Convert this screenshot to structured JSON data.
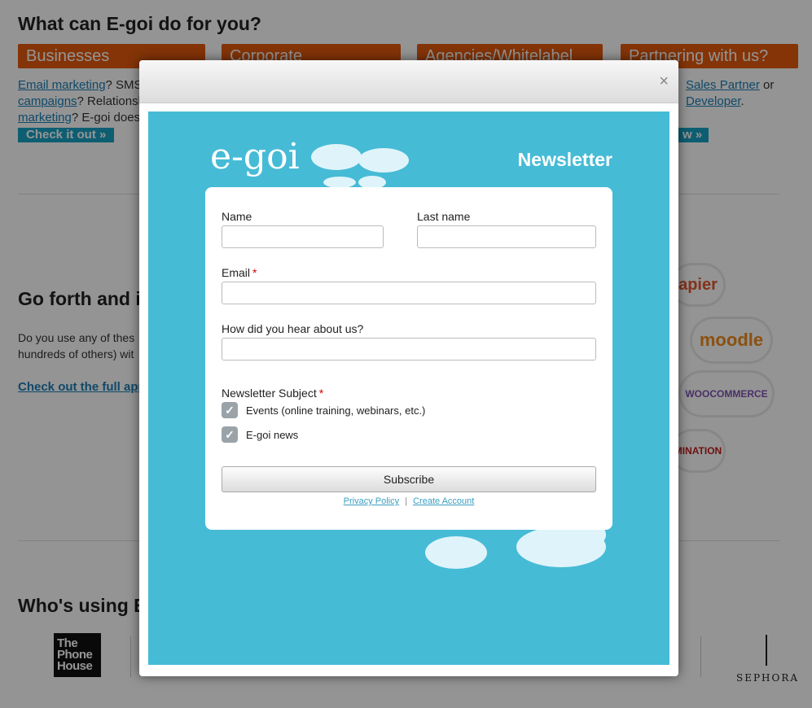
{
  "background": {
    "heading1": "What can E-goi do for you?",
    "tabs": [
      "Businesses",
      "Corporate",
      "Agencies/Whitelabel",
      "Partnering with us?"
    ],
    "col1_line1_link1": "Email marketing",
    "col1_line1_rest": "? SMS",
    "col1_line2_link": "campaigns",
    "col1_line2_rest": "? Relationsh",
    "col1_line3_link": "marketing",
    "col1_line3_rest": "? E-goi does",
    "col1_cta": "Check it out »",
    "col4_line1_link": "Sales Partner",
    "col4_line1_rest": " or",
    "col4_line2_link": "Developer",
    "col4_cta": "w »",
    "heading2": "Go forth and in",
    "para2_line1": "Do you use any of thes",
    "para2_line2": "hundreds of others) wit",
    "apps_link": "Check out the full app",
    "integrations": [
      "apier",
      "moodle",
      "WOOCOMMERCE",
      "MINATION"
    ],
    "heading3": "Who's using E",
    "brand1": "The Phone House",
    "brand2": "SEPHORA"
  },
  "modal": {
    "close_icon": "×",
    "logo": "e-goi",
    "title": "Newsletter",
    "form": {
      "name_label": "Name",
      "name_value": "",
      "lastname_label": "Last name",
      "lastname_value": "",
      "email_label": "Email",
      "email_value": "",
      "required_mark": "*",
      "hear_label": "How did you hear about us?",
      "hear_value": "",
      "subject_label": "Newsletter Subject",
      "options": [
        {
          "label": "Events (online training, webinars, etc.)",
          "checked": true
        },
        {
          "label": "E-goi news",
          "checked": true
        }
      ],
      "submit_label": "Subscribe",
      "privacy_link": "Privacy Policy",
      "separator": "|",
      "create_account_link": "Create Account"
    }
  },
  "colors": {
    "accent_orange": "#e35b0d",
    "modal_blue": "#46bbd6",
    "link_blue": "#1a7fb5"
  }
}
